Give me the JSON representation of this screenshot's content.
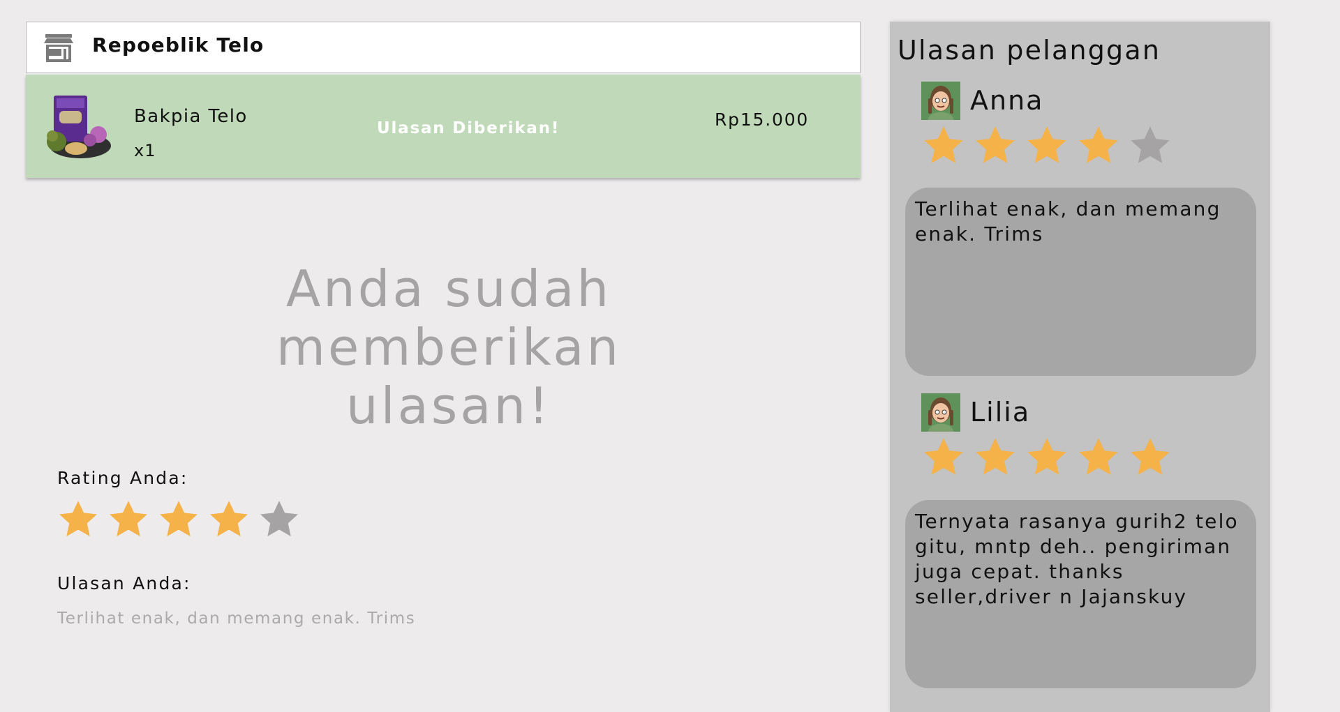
{
  "store": {
    "name": "Repoeblik Telo",
    "icon": "store-icon"
  },
  "order": {
    "product_name": "Bakpia Telo",
    "quantity": "x1",
    "status": "Ulasan Diberikan!",
    "price": "Rp15.000"
  },
  "my_review": {
    "message": "Anda sudah memberikan ulasan!",
    "rating_label": "Rating Anda:",
    "rating": 4,
    "rating_max": 5,
    "review_label": "Ulasan Anda:",
    "review_text": "Terlihat enak, dan memang enak. Trims"
  },
  "customer_reviews": {
    "title": "Ulasan pelanggan",
    "items": [
      {
        "name": "Anna",
        "rating": 4,
        "rating_max": 5,
        "text": "Terlihat enak, dan memang enak. Trims"
      },
      {
        "name": "Lilia",
        "rating": 5,
        "rating_max": 5,
        "text": "Ternyata rasanya gurih2 telo gitu, mntp deh.. pengiriman juga cepat. thanks seller,driver n Jajanskuy"
      }
    ]
  },
  "colors": {
    "star_filled": "#f4b248",
    "star_empty": "#a6a3a4",
    "order_row_bg": "#c0d9b8",
    "panel_bg": "#c3c3c3",
    "bubble_bg": "#a6a6a6"
  }
}
